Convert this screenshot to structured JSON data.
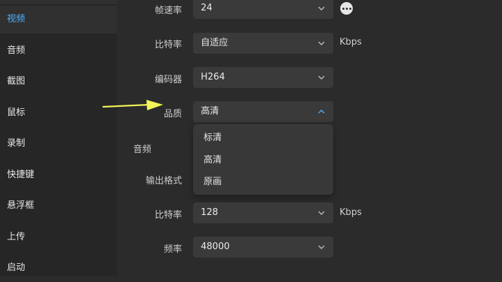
{
  "sidebar": {
    "items": [
      {
        "label": "视频",
        "active": true
      },
      {
        "label": "音频"
      },
      {
        "label": "截图"
      },
      {
        "label": "鼠标"
      },
      {
        "label": "录制"
      },
      {
        "label": "快捷键"
      },
      {
        "label": "悬浮框"
      },
      {
        "label": "上传"
      },
      {
        "label": "启动"
      }
    ]
  },
  "video": {
    "framerate": {
      "label": "帧速率",
      "value": "24"
    },
    "bitrate": {
      "label": "比特率",
      "value": "自适应",
      "unit": "Kbps"
    },
    "encoder": {
      "label": "编码器",
      "value": "H264"
    },
    "quality": {
      "label": "品质",
      "value": "高清",
      "options": [
        "标清",
        "高清",
        "原画"
      ]
    }
  },
  "audio": {
    "section_label": "音频",
    "output_format": {
      "label": "输出格式"
    },
    "bitrate": {
      "label": "比特率",
      "value": "128",
      "unit": "Kbps"
    },
    "samplerate": {
      "label": "频率",
      "value": "48000"
    }
  },
  "colors": {
    "accent": "#4cb1ff",
    "annotation_arrow": "#f2f25a",
    "background": "#2b2b2b",
    "sidebar": "#262626"
  }
}
